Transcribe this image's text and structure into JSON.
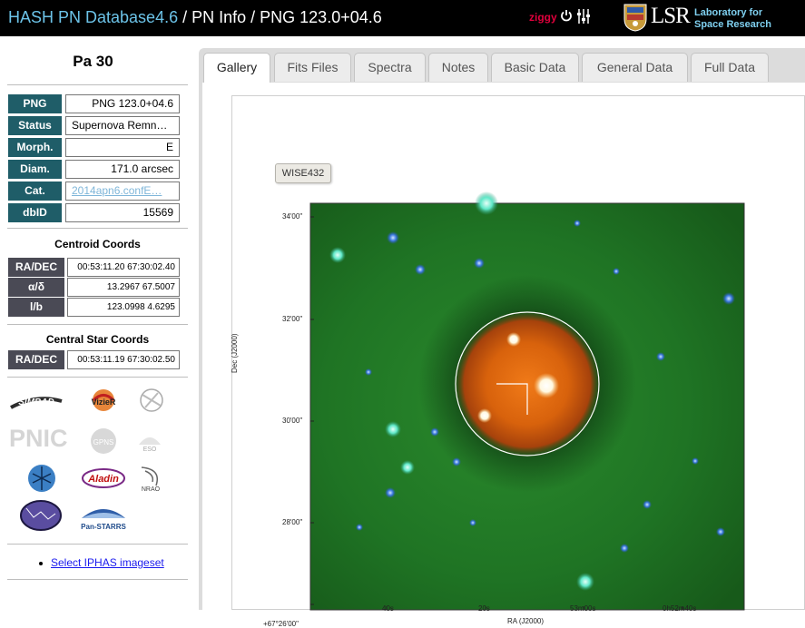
{
  "header": {
    "db_name": "HASH PN Database4.6",
    "separator": " / ",
    "crumb2": "PN Info",
    "crumb3": "PNG 123.0+04.6",
    "user": "ziggy",
    "logo_text": "LSR",
    "lab_line1": "Laboratory for",
    "lab_line2": "Space Research",
    "icons": [
      "power-icon",
      "sliders-icon",
      "university-crest-icon"
    ]
  },
  "object": {
    "name": "Pa 30",
    "fields": [
      {
        "key": "PNG",
        "value": "PNG 123.0+04.6"
      },
      {
        "key": "Status",
        "value": "Supernova Remn…"
      },
      {
        "key": "Morph.",
        "value": "E"
      },
      {
        "key": "Diam.",
        "value": "171.0 arcsec"
      },
      {
        "key": "Cat.",
        "value": "2014apn6.confE…"
      },
      {
        "key": "dbID",
        "value": "15569"
      }
    ]
  },
  "centroid": {
    "title": "Centroid Coords",
    "rows": [
      {
        "key": "RA/DEC",
        "value": "00:53:11.20 67:30:02.40"
      },
      {
        "key": "α/δ",
        "value": "13.2967 67.5007"
      },
      {
        "key": "l/b",
        "value": "123.0998 4.6295"
      }
    ]
  },
  "central_star": {
    "title": "Central Star Coords",
    "rows": [
      {
        "key": "RA/DEC",
        "value": "00:53:11.19 67:30:02.50"
      }
    ]
  },
  "logos": {
    "simbad": "SIMBAD",
    "vizier": "VizieR",
    "pnic": "PNIC",
    "aladin": "Aladin",
    "nrao": "NRAO",
    "panstarrs": "Pan-STARRS",
    "gpns": "GPNS",
    "eso": "ESO"
  },
  "ipas_link": "Select IPHAS imageset",
  "tabs": [
    "Gallery",
    "Fits Files",
    "Spectra",
    "Notes",
    "Basic Data",
    "General Data",
    "Full Data"
  ],
  "active_tab": "Gallery",
  "image": {
    "badge": "WISE432",
    "dec_ticks": [
      "34'00\"",
      "32'00\"",
      "30'00\"",
      "28'00\"",
      "+67°26'00\""
    ],
    "ra_ticks": [
      "40s",
      "20s",
      "53m00s",
      "0h52m40s"
    ],
    "xlabel": "RA (J2000)",
    "ylabel": "Dec (J2000)",
    "colors": {
      "background": "#1f7a22",
      "nebula": "#d8620c"
    }
  }
}
